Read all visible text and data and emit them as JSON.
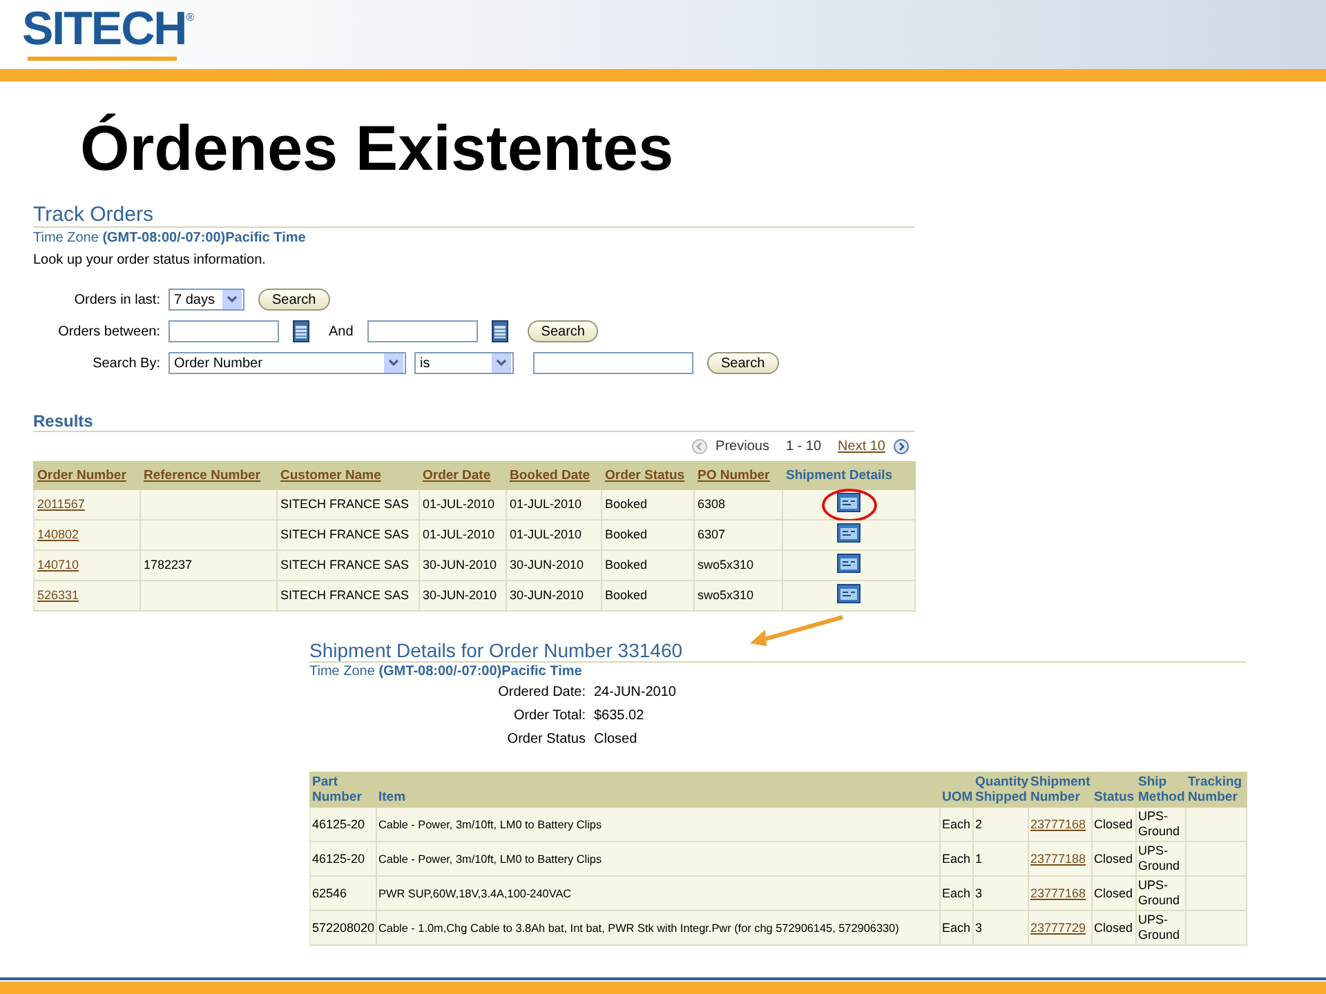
{
  "header": {
    "logo": "SITECH",
    "logo_mark": "®"
  },
  "title": "Órdenes Existentes",
  "track_orders": {
    "title": "Track Orders",
    "timezone_label": "Time Zone",
    "timezone": "(GMT-08:00/-07:00)Pacific Time",
    "intro": "Look up your order status information.",
    "filters": [
      {
        "label": "Orders in last:",
        "controls": [
          {
            "kind": "select",
            "value": "7 days"
          },
          {
            "kind": "button",
            "text": "Search"
          }
        ]
      },
      {
        "label": "Orders between:",
        "controls": [
          {
            "kind": "date"
          },
          {
            "kind": "text",
            "text": "And"
          },
          {
            "kind": "date"
          },
          {
            "kind": "button",
            "text": "Search"
          }
        ]
      },
      {
        "label": "Search By:",
        "controls": [
          {
            "kind": "select",
            "value": "Order Number"
          },
          {
            "kind": "select",
            "value": "is"
          },
          {
            "kind": "input"
          },
          {
            "kind": "button",
            "text": "Search"
          }
        ]
      }
    ]
  },
  "results": {
    "title": "Results",
    "pager": {
      "previous": "Previous",
      "range": "1 - 10",
      "next": "Next 10"
    },
    "columns": [
      {
        "label": "Order Number",
        "sortable": true
      },
      {
        "label": "Reference Number",
        "sortable": true
      },
      {
        "label": "Customer Name",
        "sortable": true
      },
      {
        "label": "Order Date",
        "sortable": true
      },
      {
        "label": "Booked Date",
        "sortable": true
      },
      {
        "label": "Order Status",
        "sortable": true
      },
      {
        "label": "PO Number",
        "sortable": true
      },
      {
        "label": "Shipment Details",
        "sortable": false
      }
    ],
    "rows": [
      {
        "order_number": "2011567",
        "reference": "",
        "customer": "SITECH FRANCE SAS",
        "order_date": "01-JUL-2010",
        "booked_date": "01-JUL-2010",
        "status": "Booked",
        "po": "6308",
        "highlighted": true
      },
      {
        "order_number": "140802",
        "reference": "",
        "customer": "SITECH FRANCE SAS",
        "order_date": "01-JUL-2010",
        "booked_date": "01-JUL-2010",
        "status": "Booked",
        "po": "6307",
        "highlighted": false
      },
      {
        "order_number": "140710",
        "reference": "1782237",
        "customer": "SITECH FRANCE SAS",
        "order_date": "30-JUN-2010",
        "booked_date": "30-JUN-2010",
        "status": "Booked",
        "po": "swo5x310",
        "highlighted": false
      },
      {
        "order_number": "526331",
        "reference": "",
        "customer": "SITECH FRANCE SAS",
        "order_date": "30-JUN-2010",
        "booked_date": "30-JUN-2010",
        "status": "Booked",
        "po": "swo5x310",
        "highlighted": false
      }
    ]
  },
  "shipment": {
    "title": "Shipment Details for Order Number 331460",
    "timezone_label": "Time Zone",
    "timezone": "(GMT-08:00/-07:00)Pacific Time",
    "info": [
      {
        "label": "Ordered Date:",
        "value": "24-JUN-2010"
      },
      {
        "label": "Order Total:",
        "value": "$635.02"
      },
      {
        "label": "Order Status",
        "value": "Closed"
      }
    ],
    "columns": [
      "Part Number",
      "Item",
      "UOM",
      "Quantity Shipped",
      "Shipment Number",
      "Status",
      "Ship Method",
      "Tracking Number"
    ],
    "rows": [
      {
        "part": "46125-20",
        "item": "Cable - Power, 3m/10ft, LM0 to Battery Clips",
        "uom": "Each",
        "qty": "2",
        "shipment_number": "23777168",
        "status": "Closed",
        "method": "UPS-Ground",
        "tracking": ""
      },
      {
        "part": "46125-20",
        "item": "Cable - Power, 3m/10ft, LM0 to Battery Clips",
        "uom": "Each",
        "qty": "1",
        "shipment_number": "23777188",
        "status": "Closed",
        "method": "UPS-Ground",
        "tracking": ""
      },
      {
        "part": "62546",
        "item": "PWR SUP,60W,18V,3.4A,100-240VAC",
        "uom": "Each",
        "qty": "3",
        "shipment_number": "23777168",
        "status": "Closed",
        "method": "UPS-Ground",
        "tracking": ""
      },
      {
        "part": "572208020",
        "item": "Cable - 1.0m,Chg Cable to 3.8Ah bat, Int bat, PWR Stk with Integr.Pwr (for chg 572906145, 572906330)",
        "uom": "Each",
        "qty": "3",
        "shipment_number": "23777729",
        "status": "Closed",
        "method": "UPS-Ground",
        "tracking": ""
      }
    ]
  }
}
